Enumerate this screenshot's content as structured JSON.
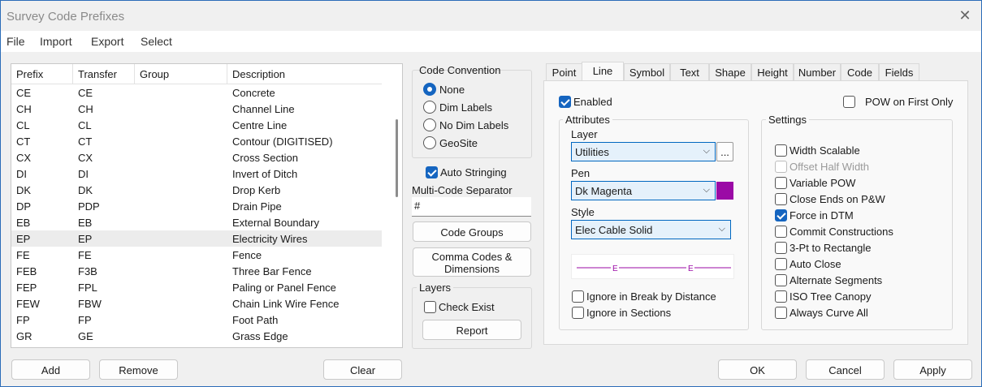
{
  "window": {
    "title": "Survey Code Prefixes"
  },
  "menu": [
    "File",
    "Import",
    "Export",
    "Select"
  ],
  "table": {
    "columns": [
      "Prefix",
      "Transfer",
      "Group",
      "Description"
    ],
    "rows": [
      [
        "CE",
        "CE",
        "",
        "Concrete"
      ],
      [
        "CH",
        "CH",
        "",
        "Channel Line"
      ],
      [
        "CL",
        "CL",
        "",
        "Centre Line"
      ],
      [
        "CT",
        "CT",
        "",
        "Contour (DIGITISED)"
      ],
      [
        "CX",
        "CX",
        "",
        "Cross Section"
      ],
      [
        "DI",
        "DI",
        "",
        "Invert of Ditch"
      ],
      [
        "DK",
        "DK",
        "",
        "Drop Kerb"
      ],
      [
        "DP",
        "PDP",
        "",
        "Drain Pipe"
      ],
      [
        "EB",
        "EB",
        "",
        "External Boundary"
      ],
      [
        "EP",
        "EP",
        "",
        "Electricity Wires"
      ],
      [
        "FE",
        "FE",
        "",
        "Fence"
      ],
      [
        "FEB",
        "F3B",
        "",
        "Three Bar Fence"
      ],
      [
        "FEP",
        "FPL",
        "",
        "Paling or Panel Fence"
      ],
      [
        "FEW",
        "FBW",
        "",
        "Chain Link  Wire Fence"
      ],
      [
        "FP",
        "FP",
        "",
        "Foot Path"
      ],
      [
        "GR",
        "GE",
        "",
        "Grass Edge"
      ]
    ],
    "selected_index": 9
  },
  "code_convention": {
    "label": "Code Convention",
    "options": [
      "None",
      "Dim Labels",
      "No Dim Labels",
      "GeoSite"
    ],
    "selected": "None"
  },
  "auto_stringing": {
    "label": "Auto Stringing",
    "checked": true
  },
  "multi_code": {
    "label": "Multi-Code Separator",
    "value": "#"
  },
  "buttons": {
    "code_groups": "Code Groups",
    "comma_codes_1": "Comma Codes &",
    "comma_codes_2": "Dimensions",
    "report": "Report",
    "add": "Add",
    "remove": "Remove",
    "clear": "Clear",
    "ok": "OK",
    "cancel": "Cancel",
    "apply": "Apply",
    "ellipsis": "..."
  },
  "layers": {
    "label": "Layers",
    "check_exist": "Check Exist",
    "checked": false
  },
  "tabs": [
    "Point",
    "Line",
    "Symbol",
    "Text",
    "Shape",
    "Height",
    "Number",
    "Code",
    "Fields"
  ],
  "active_tab": "Line",
  "line": {
    "enabled": {
      "label": "Enabled",
      "checked": true
    },
    "pow_first": {
      "label": "POW on First Only",
      "checked": false
    },
    "attributes": {
      "label": "Attributes",
      "layer_label": "Layer",
      "layer_value": "Utilities",
      "pen_label": "Pen",
      "pen_value": "Dk Magenta",
      "pen_color": "#9b0aa6",
      "style_label": "Style",
      "style_value": "Elec Cable Solid",
      "preview_marker": "E"
    },
    "ignore_break": {
      "label": "Ignore in Break by Distance",
      "checked": false
    },
    "ignore_sections": {
      "label": "Ignore in Sections",
      "checked": false
    },
    "settings": {
      "label": "Settings",
      "items": [
        {
          "label": "Width Scalable",
          "checked": false,
          "disabled": false
        },
        {
          "label": "Offset Half Width",
          "checked": false,
          "disabled": true
        },
        {
          "label": "Variable POW",
          "checked": false,
          "disabled": false
        },
        {
          "label": "Close Ends on P&W",
          "checked": false,
          "disabled": false
        },
        {
          "label": "Force in DTM",
          "checked": true,
          "disabled": false
        },
        {
          "label": "Commit Constructions",
          "checked": false,
          "disabled": false
        },
        {
          "label": "3-Pt to Rectangle",
          "checked": false,
          "disabled": false
        },
        {
          "label": "Auto Close",
          "checked": false,
          "disabled": false
        },
        {
          "label": "Alternate Segments",
          "checked": false,
          "disabled": false
        },
        {
          "label": "ISO Tree Canopy",
          "checked": false,
          "disabled": false
        },
        {
          "label": "Always Curve All",
          "checked": false,
          "disabled": false
        }
      ]
    }
  }
}
